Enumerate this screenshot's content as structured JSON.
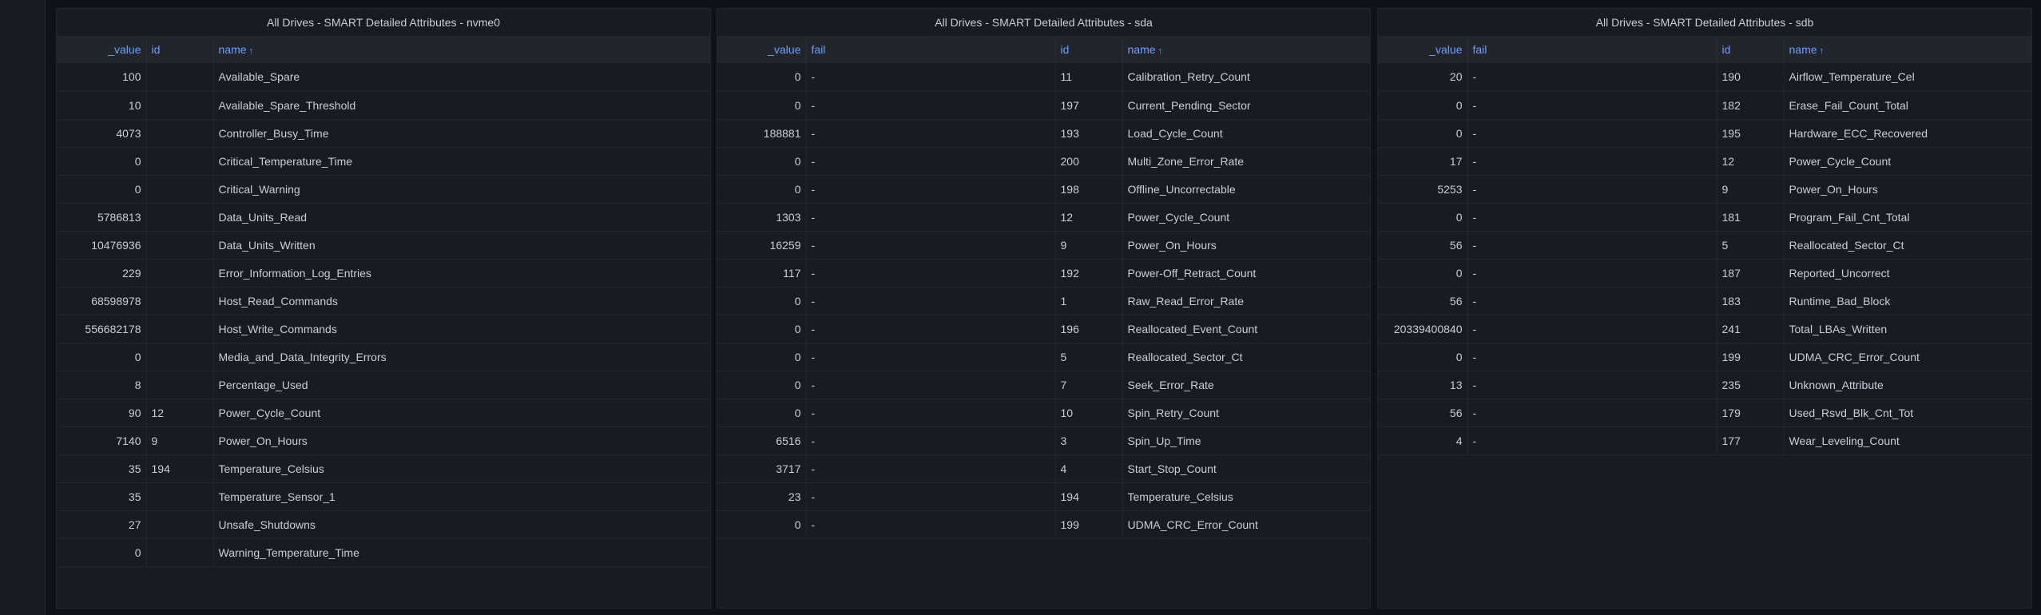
{
  "panels": [
    {
      "title": "All Drives - SMART Detailed Attributes - nvme0",
      "columns": [
        "_value",
        "id",
        "name"
      ],
      "sorted_column": "name",
      "rows": [
        [
          "100",
          "",
          "Available_Spare"
        ],
        [
          "10",
          "",
          "Available_Spare_Threshold"
        ],
        [
          "4073",
          "",
          "Controller_Busy_Time"
        ],
        [
          "0",
          "",
          "Critical_Temperature_Time"
        ],
        [
          "0",
          "",
          "Critical_Warning"
        ],
        [
          "5786813",
          "",
          "Data_Units_Read"
        ],
        [
          "10476936",
          "",
          "Data_Units_Written"
        ],
        [
          "229",
          "",
          "Error_Information_Log_Entries"
        ],
        [
          "68598978",
          "",
          "Host_Read_Commands"
        ],
        [
          "556682178",
          "",
          "Host_Write_Commands"
        ],
        [
          "0",
          "",
          "Media_and_Data_Integrity_Errors"
        ],
        [
          "8",
          "",
          "Percentage_Used"
        ],
        [
          "90",
          "12",
          "Power_Cycle_Count"
        ],
        [
          "7140",
          "9",
          "Power_On_Hours"
        ],
        [
          "35",
          "194",
          "Temperature_Celsius"
        ],
        [
          "35",
          "",
          "Temperature_Sensor_1"
        ],
        [
          "27",
          "",
          "Unsafe_Shutdowns"
        ],
        [
          "0",
          "",
          "Warning_Temperature_Time"
        ]
      ]
    },
    {
      "title": "All Drives - SMART Detailed Attributes - sda",
      "columns": [
        "_value",
        "fail",
        "id",
        "name"
      ],
      "sorted_column": "name",
      "rows": [
        [
          "0",
          "-",
          "11",
          "Calibration_Retry_Count"
        ],
        [
          "0",
          "-",
          "197",
          "Current_Pending_Sector"
        ],
        [
          "188881",
          "-",
          "193",
          "Load_Cycle_Count"
        ],
        [
          "0",
          "-",
          "200",
          "Multi_Zone_Error_Rate"
        ],
        [
          "0",
          "-",
          "198",
          "Offline_Uncorrectable"
        ],
        [
          "1303",
          "-",
          "12",
          "Power_Cycle_Count"
        ],
        [
          "16259",
          "-",
          "9",
          "Power_On_Hours"
        ],
        [
          "117",
          "-",
          "192",
          "Power-Off_Retract_Count"
        ],
        [
          "0",
          "-",
          "1",
          "Raw_Read_Error_Rate"
        ],
        [
          "0",
          "-",
          "196",
          "Reallocated_Event_Count"
        ],
        [
          "0",
          "-",
          "5",
          "Reallocated_Sector_Ct"
        ],
        [
          "0",
          "-",
          "7",
          "Seek_Error_Rate"
        ],
        [
          "0",
          "-",
          "10",
          "Spin_Retry_Count"
        ],
        [
          "6516",
          "-",
          "3",
          "Spin_Up_Time"
        ],
        [
          "3717",
          "-",
          "4",
          "Start_Stop_Count"
        ],
        [
          "23",
          "-",
          "194",
          "Temperature_Celsius"
        ],
        [
          "0",
          "-",
          "199",
          "UDMA_CRC_Error_Count"
        ]
      ]
    },
    {
      "title": "All Drives - SMART Detailed Attributes - sdb",
      "columns": [
        "_value",
        "fail",
        "id",
        "name"
      ],
      "sorted_column": "name",
      "rows": [
        [
          "20",
          "-",
          "190",
          "Airflow_Temperature_Cel"
        ],
        [
          "0",
          "-",
          "182",
          "Erase_Fail_Count_Total"
        ],
        [
          "0",
          "-",
          "195",
          "Hardware_ECC_Recovered"
        ],
        [
          "17",
          "-",
          "12",
          "Power_Cycle_Count"
        ],
        [
          "5253",
          "-",
          "9",
          "Power_On_Hours"
        ],
        [
          "0",
          "-",
          "181",
          "Program_Fail_Cnt_Total"
        ],
        [
          "56",
          "-",
          "5",
          "Reallocated_Sector_Ct"
        ],
        [
          "0",
          "-",
          "187",
          "Reported_Uncorrect"
        ],
        [
          "56",
          "-",
          "183",
          "Runtime_Bad_Block"
        ],
        [
          "20339400840",
          "-",
          "241",
          "Total_LBAs_Written"
        ],
        [
          "0",
          "-",
          "199",
          "UDMA_CRC_Error_Count"
        ],
        [
          "13",
          "-",
          "235",
          "Unknown_Attribute"
        ],
        [
          "56",
          "-",
          "179",
          "Used_Rsvd_Blk_Cnt_Tot"
        ],
        [
          "4",
          "-",
          "177",
          "Wear_Leveling_Count"
        ]
      ]
    }
  ],
  "icons": {
    "sort": "arrow-up-icon"
  },
  "colors": {
    "header_text": "#6e9fff",
    "background": "#111217",
    "panel": "#181b1f"
  }
}
